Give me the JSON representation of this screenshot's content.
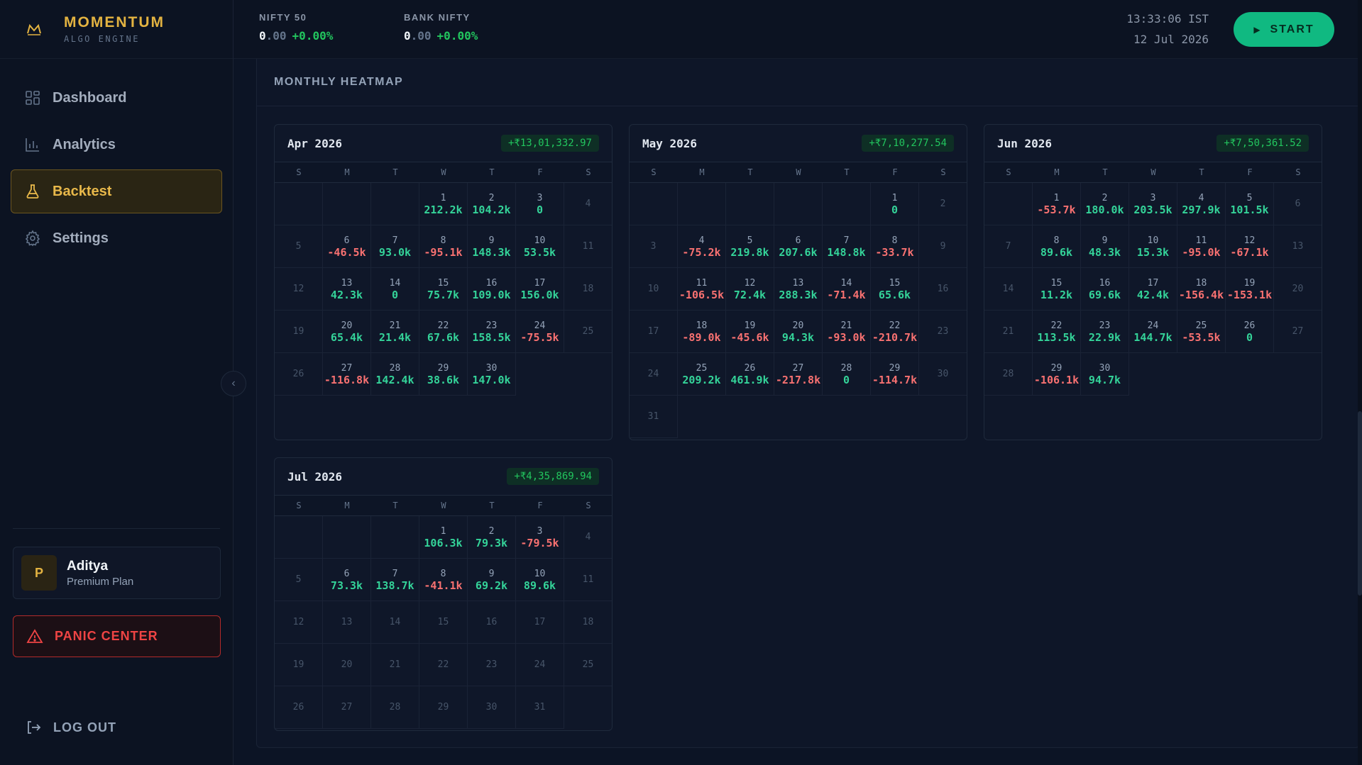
{
  "brand": {
    "name": "MOMENTUM",
    "sub": "ALGO ENGINE"
  },
  "nav": [
    {
      "label": "Dashboard",
      "icon": "dashboard-icon",
      "active": false
    },
    {
      "label": "Analytics",
      "icon": "bar-chart-icon",
      "active": false
    },
    {
      "label": "Backtest",
      "icon": "flask-icon",
      "active": true
    },
    {
      "label": "Settings",
      "icon": "gear-icon",
      "active": false
    }
  ],
  "user": {
    "initial": "P",
    "name": "Aditya",
    "plan": "Premium Plan"
  },
  "panic_label": "PANIC CENTER",
  "logout_label": "LOG OUT",
  "tickers": [
    {
      "name": "NIFTY 50",
      "int": "0",
      "dec": ".00",
      "change": "+0.00%"
    },
    {
      "name": "BANK NIFTY",
      "int": "0",
      "dec": ".00",
      "change": "+0.00%"
    }
  ],
  "clock": {
    "time": "13:33:06 IST",
    "date": "12 Jul 2026"
  },
  "start_label": "START",
  "heatmap": {
    "title": "MONTHLY HEATMAP",
    "dow": [
      "S",
      "M",
      "T",
      "W",
      "T",
      "F",
      "S"
    ],
    "months": [
      {
        "name": "Apr 2026",
        "total": "+₹13,01,332.97",
        "offset": 3,
        "days": 30,
        "values": {
          "1": "212.2k",
          "2": "104.2k",
          "3": "0",
          "6": "-46.5k",
          "7": "93.0k",
          "8": "-95.1k",
          "9": "148.3k",
          "10": "53.5k",
          "13": "42.3k",
          "14": "0",
          "15": "75.7k",
          "16": "109.0k",
          "17": "156.0k",
          "20": "65.4k",
          "21": "21.4k",
          "22": "67.6k",
          "23": "158.5k",
          "24": "-75.5k",
          "27": "-116.8k",
          "28": "142.4k",
          "29": "38.6k",
          "30": "147.0k"
        }
      },
      {
        "name": "May 2026",
        "total": "+₹7,10,277.54",
        "offset": 5,
        "days": 31,
        "values": {
          "1": "0",
          "4": "-75.2k",
          "5": "219.8k",
          "6": "207.6k",
          "7": "148.8k",
          "8": "-33.7k",
          "11": "-106.5k",
          "12": "72.4k",
          "13": "288.3k",
          "14": "-71.4k",
          "15": "65.6k",
          "18": "-89.0k",
          "19": "-45.6k",
          "20": "94.3k",
          "21": "-93.0k",
          "22": "-210.7k",
          "25": "209.2k",
          "26": "461.9k",
          "27": "-217.8k",
          "28": "0",
          "29": "-114.7k"
        }
      },
      {
        "name": "Jun 2026",
        "total": "+₹7,50,361.52",
        "offset": 1,
        "days": 30,
        "values": {
          "1": "-53.7k",
          "2": "180.0k",
          "3": "203.5k",
          "4": "297.9k",
          "5": "101.5k",
          "8": "89.6k",
          "9": "48.3k",
          "10": "15.3k",
          "11": "-95.0k",
          "12": "-67.1k",
          "15": "11.2k",
          "16": "69.6k",
          "17": "42.4k",
          "18": "-156.4k",
          "19": "-153.1k",
          "22": "113.5k",
          "23": "22.9k",
          "24": "144.7k",
          "25": "-53.5k",
          "26": "0",
          "29": "-106.1k",
          "30": "94.7k"
        }
      },
      {
        "name": "Jul 2026",
        "total": "+₹4,35,869.94",
        "offset": 3,
        "days": 31,
        "values": {
          "1": "106.3k",
          "2": "79.3k",
          "3": "-79.5k",
          "6": "73.3k",
          "7": "138.7k",
          "8": "-41.1k",
          "9": "69.2k",
          "10": "89.6k"
        }
      }
    ]
  }
}
